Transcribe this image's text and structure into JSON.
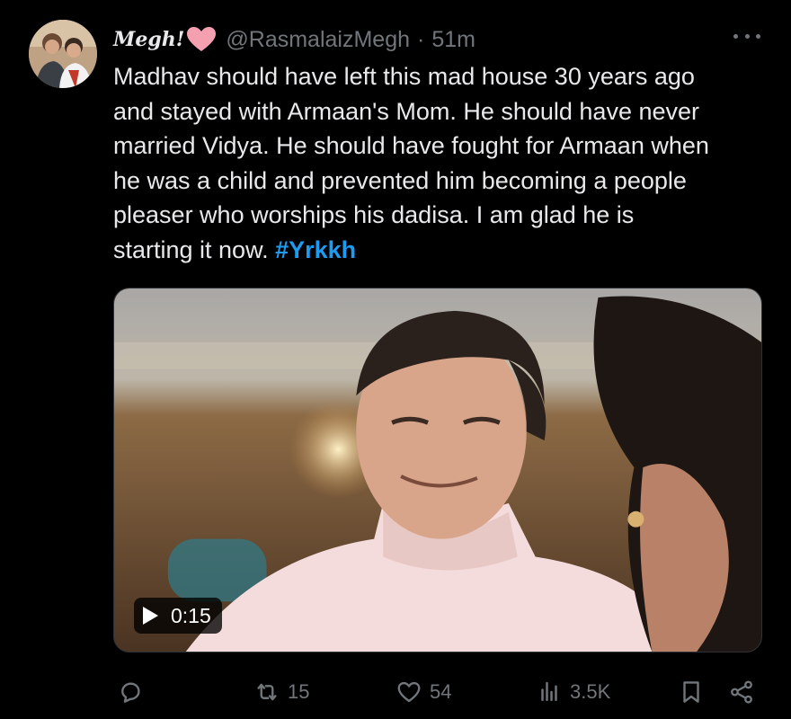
{
  "tweet": {
    "display_name": "Megh!",
    "handle": "@RasmalaizMegh",
    "separator": "·",
    "time": "51m",
    "text": "Madhav should have left this mad house 30 years ago\nand stayed with Armaan's Mom. He should have never\nmarried Vidya. He should have fought for Armaan when\nhe was a child and prevented him becoming a people\npleaser who worships his dadisa. I am glad he is\nstarting it now. ",
    "hashtag": "#Yrkkh"
  },
  "media": {
    "duration": "0:15"
  },
  "actions": {
    "reposts": "15",
    "likes": "54",
    "views": "3.5K"
  },
  "colors": {
    "background": "#000000",
    "text": "#e7e9ea",
    "muted": "#71767b",
    "link": "#1d9bf0",
    "heart": "#f4a0b0"
  }
}
